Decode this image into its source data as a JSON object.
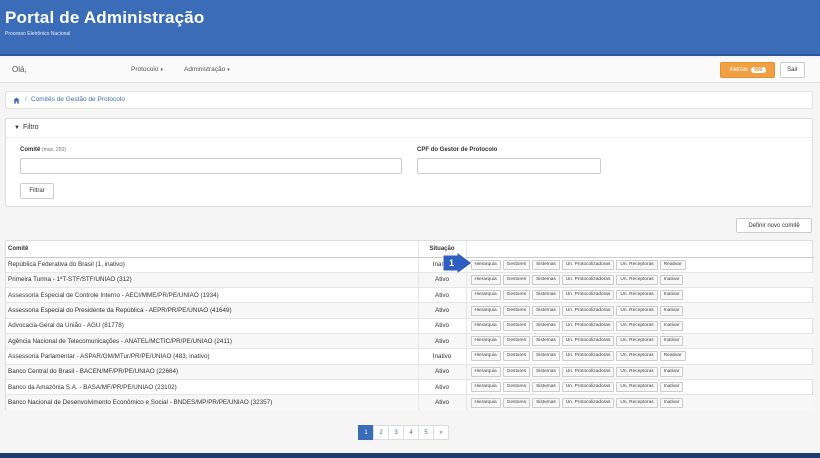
{
  "header": {
    "title": "Portal de Administração",
    "subtitle": "Processo Eletrônico Nacional"
  },
  "navbar": {
    "greeting": "Olá,",
    "menu": [
      {
        "label": "Protocolo"
      },
      {
        "label": "Administração"
      }
    ],
    "alerts_label": "Alertas",
    "alerts_count": "999",
    "exit_label": "Sair"
  },
  "breadcrumb": {
    "items": [
      "Comitês de Gestão de Protocolo"
    ]
  },
  "filter": {
    "title": "Filtro",
    "committee_label": "Comitê",
    "committee_hint": "(max. 250)",
    "committee_value": "",
    "cpf_label": "CPF do Gestor de Protocolo",
    "cpf_value": "",
    "submit_label": "Filtrar"
  },
  "define_button": "Definir novo comitê",
  "table": {
    "headers": {
      "name": "Comitê",
      "status": "Situação"
    },
    "actions": [
      "Hierarquia",
      "Gestores",
      "Sistemas",
      "Un. Protocolizadoras",
      "Un. Receptoras"
    ],
    "rows": [
      {
        "name": "República Federativa do Brasil (1, inativo)",
        "status": "Inativo",
        "toggle": "Reativar"
      },
      {
        "name": "Primeira Turma - 1ªT-STF/STF/UNIAO (312)",
        "status": "Ativo",
        "toggle": "Inativar"
      },
      {
        "name": "Assessoria Especial de Controle Interno - AECI/MME/PR/PE/UNIAO (1934)",
        "status": "Ativo",
        "toggle": "Inativar"
      },
      {
        "name": "Assessoria Especial do Presidente da República - AEPR/PR/PE/UNIAO (41649)",
        "status": "Ativo",
        "toggle": "Inativar"
      },
      {
        "name": "Advocacia-Geral da União - AGU (81778)",
        "status": "Ativo",
        "toggle": "Inativar"
      },
      {
        "name": "Agência Nacional de Telecomunicações - ANATEL/MCTIC/PR/PE/UNIAO (2411)",
        "status": "Ativo",
        "toggle": "Inativar"
      },
      {
        "name": "Assessoria Parlamentar - ASPAR/GM/MTur/PR/PE/UNIAO (483, inativo)",
        "status": "Inativo",
        "toggle": "Reativar"
      },
      {
        "name": "Banco Central do Brasil - BACEN/MF/PR/PE/UNIAO (22664)",
        "status": "Ativo",
        "toggle": "Inativar"
      },
      {
        "name": "Banco da Amazônia S.A. - BASA/MF/PR/PE/UNIAO (23102)",
        "status": "Ativo",
        "toggle": "Inativar"
      },
      {
        "name": "Banco Nacional de Desenvolvimento Econômico e Social - BNDES/MP/PR/PE/UNIAO (32357)",
        "status": "Ativo",
        "toggle": "Inativar"
      }
    ]
  },
  "callout_number": "1",
  "pagination": {
    "pages": [
      "1",
      "2",
      "3",
      "4",
      "5"
    ],
    "next": "»",
    "active": "1"
  },
  "colors": {
    "brand": "#3b6cb8",
    "alert": "#f0a044"
  }
}
